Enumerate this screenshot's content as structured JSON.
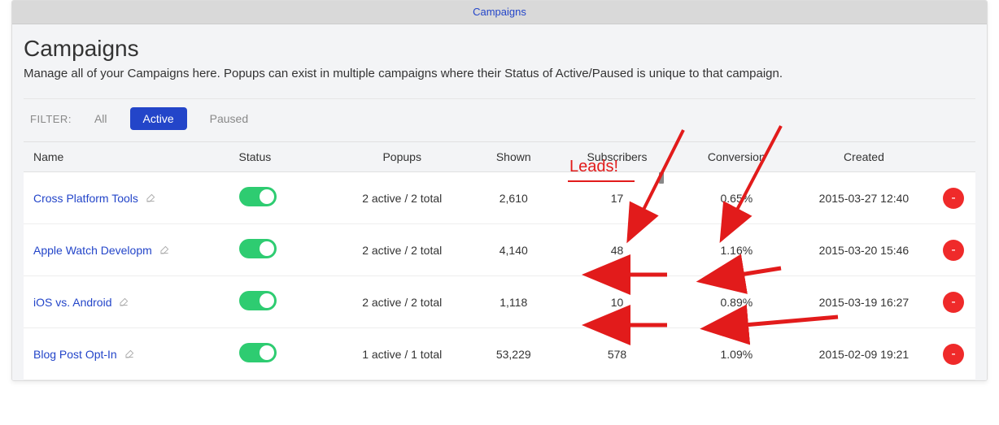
{
  "top_tab": "Campaigns",
  "page": {
    "title": "Campaigns",
    "description": "Manage all of your Campaigns here. Popups can exist in multiple campaigns where their Status of Active/Paused is unique to that campaign."
  },
  "filter": {
    "label": "FILTER:",
    "all": "All",
    "active": "Active",
    "paused": "Paused"
  },
  "columns": {
    "name": "Name",
    "status": "Status",
    "popups": "Popups",
    "shown": "Shown",
    "subscribers": "Subscribers",
    "conversion": "Conversion",
    "created": "Created"
  },
  "rows": [
    {
      "name": "Cross Platform Tools",
      "popups": "2 active / 2 total",
      "shown": "2,610",
      "subs": "17",
      "conv": "0.65%",
      "created": "2015-03-27 12:40"
    },
    {
      "name": "Apple Watch Developm",
      "popups": "2 active / 2 total",
      "shown": "4,140",
      "subs": "48",
      "conv": "1.16%",
      "created": "2015-03-20 15:46"
    },
    {
      "name": "iOS vs. Android",
      "popups": "2 active / 2 total",
      "shown": "1,118",
      "subs": "10",
      "conv": "0.89%",
      "created": "2015-03-19 16:27"
    },
    {
      "name": "Blog Post Opt-In",
      "popups": "1 active / 1 total",
      "shown": "53,229",
      "subs": "578",
      "conv": "1.09%",
      "created": "2015-02-09 19:21"
    }
  ],
  "annotation": {
    "leads": "Leads!"
  },
  "buttons": {
    "delete_glyph": "-"
  }
}
